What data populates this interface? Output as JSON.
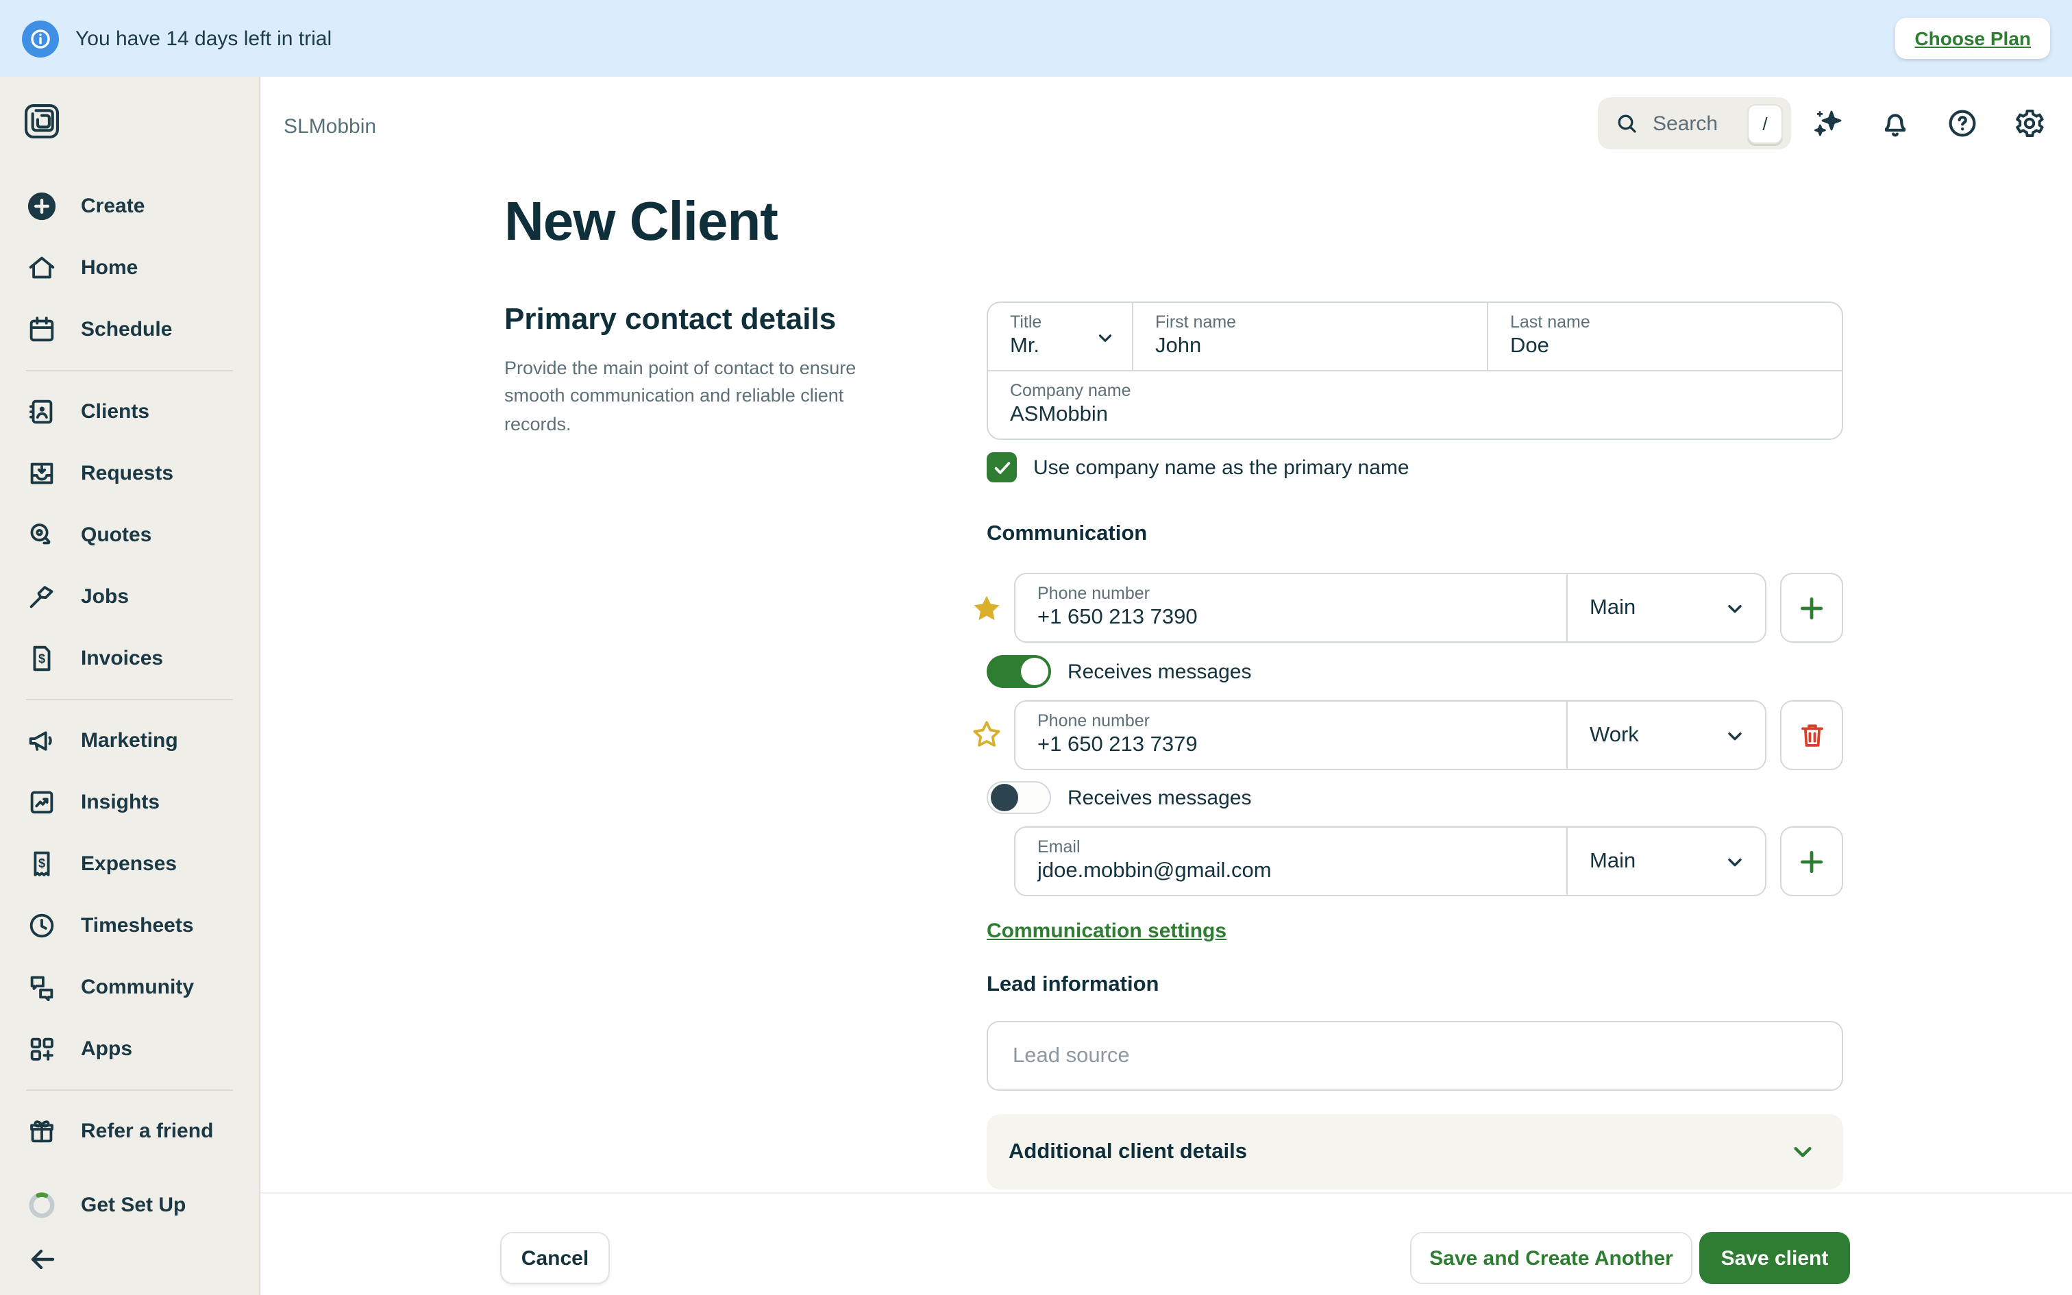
{
  "banner": {
    "message": "You have 14 days left in trial",
    "action_label": "Choose Plan"
  },
  "sidebar": {
    "items": [
      {
        "label": "Create"
      },
      {
        "label": "Home"
      },
      {
        "label": "Schedule"
      },
      {
        "label": "Clients"
      },
      {
        "label": "Requests"
      },
      {
        "label": "Quotes"
      },
      {
        "label": "Jobs"
      },
      {
        "label": "Invoices"
      },
      {
        "label": "Marketing"
      },
      {
        "label": "Insights"
      },
      {
        "label": "Expenses"
      },
      {
        "label": "Timesheets"
      },
      {
        "label": "Community"
      },
      {
        "label": "Apps"
      },
      {
        "label": "Refer a friend"
      },
      {
        "label": "Get Set Up"
      }
    ]
  },
  "header": {
    "account_name": "SLMobbin",
    "search_placeholder": "Search",
    "search_shortcut": "/"
  },
  "page": {
    "title": "New Client"
  },
  "primary_section": {
    "heading": "Primary contact details",
    "description": "Provide the main point of contact to ensure smooth communication and reliable client records."
  },
  "name_fields": {
    "title_label": "Title",
    "title_value": "Mr.",
    "first_label": "First name",
    "first_value": "John",
    "last_label": "Last name",
    "last_value": "Doe",
    "company_label": "Company name",
    "company_value": "ASMobbin"
  },
  "company_checkbox": {
    "checked": true,
    "label": "Use company name as the primary name"
  },
  "communication": {
    "heading": "Communication",
    "rows": [
      {
        "label": "Phone number",
        "value": "+1 650 213 7390",
        "type": "Main",
        "starred": true,
        "action": "add",
        "toggle": {
          "label": "Receives messages",
          "on": true
        }
      },
      {
        "label": "Phone number",
        "value": "+1 650 213 7379",
        "type": "Work",
        "starred": false,
        "action": "delete",
        "toggle": {
          "label": "Receives messages",
          "on": false
        }
      },
      {
        "label": "Email",
        "value": "jdoe.mobbin@gmail.com",
        "type": "Main",
        "action": "add"
      }
    ],
    "settings_link": "Communication settings"
  },
  "lead": {
    "heading": "Lead information",
    "source_placeholder": "Lead source"
  },
  "additional": {
    "label": "Additional client details"
  },
  "footer": {
    "cancel": "Cancel",
    "save_create_another": "Save and Create Another",
    "save": "Save client"
  },
  "colors": {
    "accent_green": "#2e7d32",
    "banner_blue_bg": "#dbecfc",
    "banner_icon_blue": "#3f90e5",
    "sidebar_bg": "#f0eee8",
    "heading_navy": "#0f2f3a",
    "star_gold": "#d9af2b",
    "trash_red": "#d8402c"
  }
}
